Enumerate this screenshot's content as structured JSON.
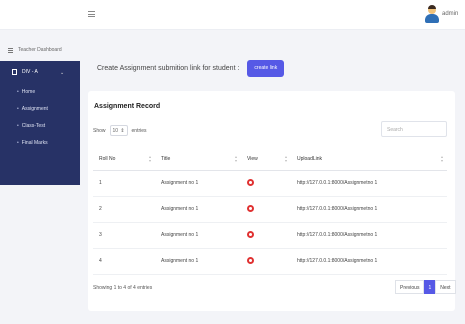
{
  "topbar": {
    "username": "admin"
  },
  "sidebar": {
    "dashboard_label": "Teacher Dashboard",
    "division_label": "DIV - A",
    "items": [
      {
        "label": "Home"
      },
      {
        "label": "Assignment"
      },
      {
        "label": "Class-Test"
      },
      {
        "label": "Final Marks"
      }
    ]
  },
  "header": {
    "text": "Create Assignment submition link for student :",
    "button_label": "create link"
  },
  "record": {
    "title": "Assignment Record",
    "show_label": "Show",
    "entries_value": "10",
    "entries_label": "entries",
    "search_placeholder": "Search",
    "columns": [
      "Roll No",
      "Title",
      "View",
      "UploadLink"
    ],
    "rows": [
      {
        "roll": "1",
        "title": "Assignment no 1",
        "link": "http://127.0.0.1:8000/Assignmetno 1"
      },
      {
        "roll": "2",
        "title": "Assignment no 1",
        "link": "http://127.0.0.1:8000/Assignmetno 1"
      },
      {
        "roll": "3",
        "title": "Assignment no 1",
        "link": "http://127.0.0.1:8000/Assignmetno 1"
      },
      {
        "roll": "4",
        "title": "Assignment no 1",
        "link": "http://127.0.0.1:8000/Assignmetno 1"
      }
    ],
    "showing_text": "Showing 1 to 4 of 4 entries",
    "pagination": {
      "previous": "Previous",
      "current": "1",
      "next": "Next"
    }
  },
  "colors": {
    "sidebar_panel": "#273266",
    "accent": "#5659e6",
    "view_icon": "#e03131"
  }
}
